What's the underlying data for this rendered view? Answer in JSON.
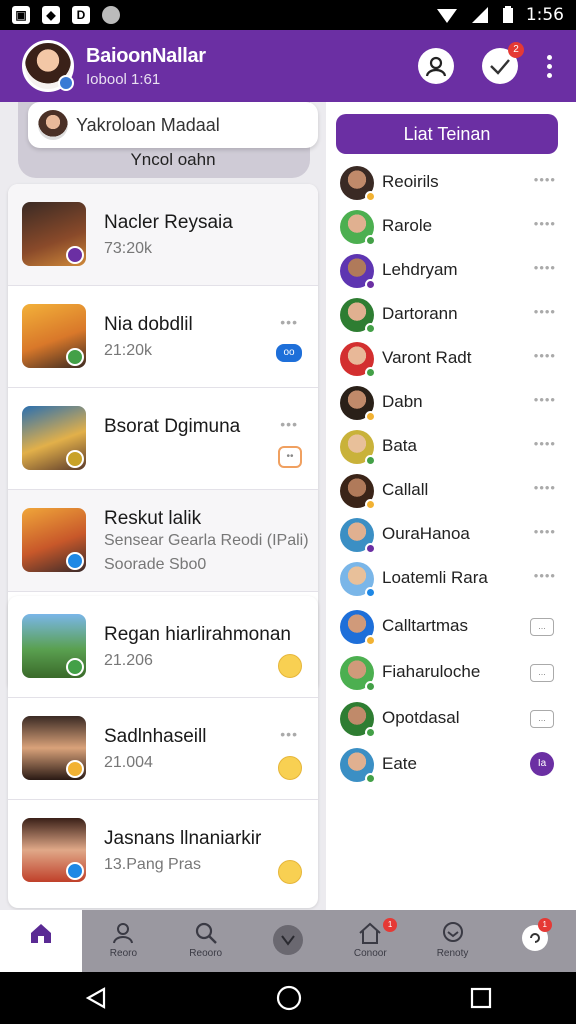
{
  "statusbar": {
    "time": "1:56",
    "icons": [
      "photo-notification-icon",
      "gallery-icon",
      "app-icon",
      "globe-icon"
    ]
  },
  "header": {
    "name": "BaioonNallar",
    "subtitle": "Iobool 1:61",
    "notif_count": "2"
  },
  "search": {
    "placeholder": "Yakroloan Madaal",
    "caption": "Yncol oahn"
  },
  "conversations": [
    {
      "name": "Nacler Reysaia",
      "meta": "73:20k",
      "meta2": ""
    },
    {
      "name": "Nia dobdlil",
      "meta": "21:20k",
      "meta2": ""
    },
    {
      "name": "Bsorat Dgimuna",
      "meta": "",
      "meta2": ""
    },
    {
      "name": "Reskut lalik",
      "meta": "Sensear Gearla Reodi (IPali)",
      "meta2": "Soorade Sbo0"
    },
    {
      "name": "Regan hiarlirahmonan",
      "meta": "21.206",
      "meta2": ""
    },
    {
      "name": "Sadlnhaseill",
      "meta": "21.004",
      "meta2": ""
    },
    {
      "name": "Jasnans llnaniarkir",
      "meta": "13.Pang Pras",
      "meta2": ""
    }
  ],
  "friends": {
    "button": "Liat Teinan",
    "items": [
      {
        "name": "Reoirils"
      },
      {
        "name": "Rarole"
      },
      {
        "name": "Lehdryam"
      },
      {
        "name": "Dartorann"
      },
      {
        "name": "Varont Radt"
      },
      {
        "name": "Dabn"
      },
      {
        "name": "Bata"
      },
      {
        "name": "Callall"
      },
      {
        "name": "OuraHanoa"
      },
      {
        "name": "Loatemli Rara"
      },
      {
        "name": "Calltartmas"
      },
      {
        "name": "Fiaharuloche"
      },
      {
        "name": "Opotdasal"
      },
      {
        "name": "Eate"
      }
    ],
    "chip": "...",
    "purple_chip": "Ia"
  },
  "bottomnav": [
    {
      "label": "",
      "icon": "home-icon"
    },
    {
      "label": "Reoro",
      "icon": "person-icon"
    },
    {
      "label": "Reooro",
      "icon": "search-icon"
    },
    {
      "label": "",
      "icon": "center-app-icon"
    },
    {
      "label": "Conoor",
      "icon": "home-outline-icon",
      "badge": "1"
    },
    {
      "label": "Renoty",
      "icon": "chat-icon"
    },
    {
      "label": "",
      "icon": "notification-icon",
      "badge": "1"
    }
  ]
}
